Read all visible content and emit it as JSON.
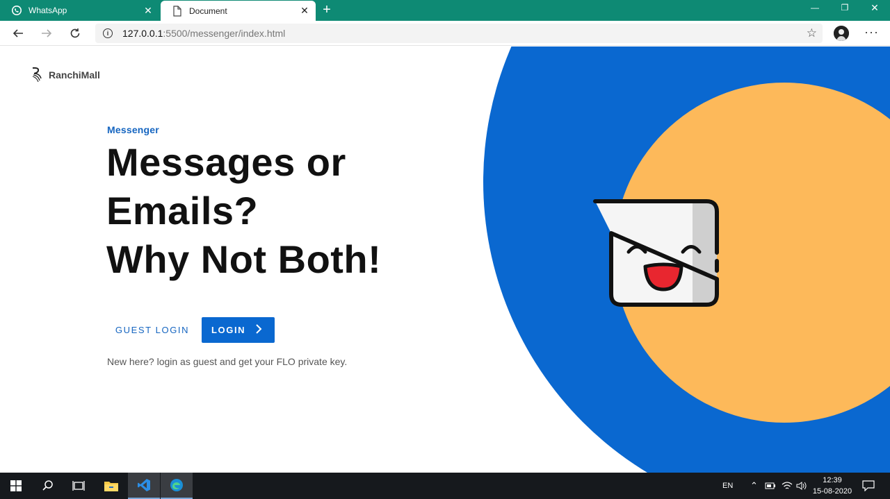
{
  "browser": {
    "tabs": [
      {
        "title": "WhatsApp",
        "icon": "whatsapp-icon",
        "active": false
      },
      {
        "title": "Document",
        "icon": "document-icon",
        "active": true
      }
    ],
    "close_glyph": "✕",
    "new_tab_glyph": "+",
    "window_controls": {
      "minimize": "—",
      "restore": "❐",
      "close": "✕"
    },
    "address": {
      "host": "127.0.0.1",
      "rest": ":5500/messenger/index.html"
    },
    "colors": {
      "titlebar": "#0e8a74"
    }
  },
  "page": {
    "brand": "RanchiMall",
    "eyebrow": "Messenger",
    "headline": [
      "Messages or",
      "Emails?",
      "Why Not Both!"
    ],
    "guest_login_label": "GUEST LOGIN",
    "login_label": "LOGIN",
    "hint": "New here? login as guest and get your FLO private key.",
    "colors": {
      "primary": "#0a68d0",
      "accent": "#fdb95a"
    }
  },
  "taskbar": {
    "language": "EN",
    "time": "12:39",
    "date": "15-08-2020",
    "items": [
      "windows-start-icon",
      "search-icon",
      "task-view-icon",
      "file-explorer-icon",
      "vscode-icon",
      "edge-icon"
    ]
  }
}
